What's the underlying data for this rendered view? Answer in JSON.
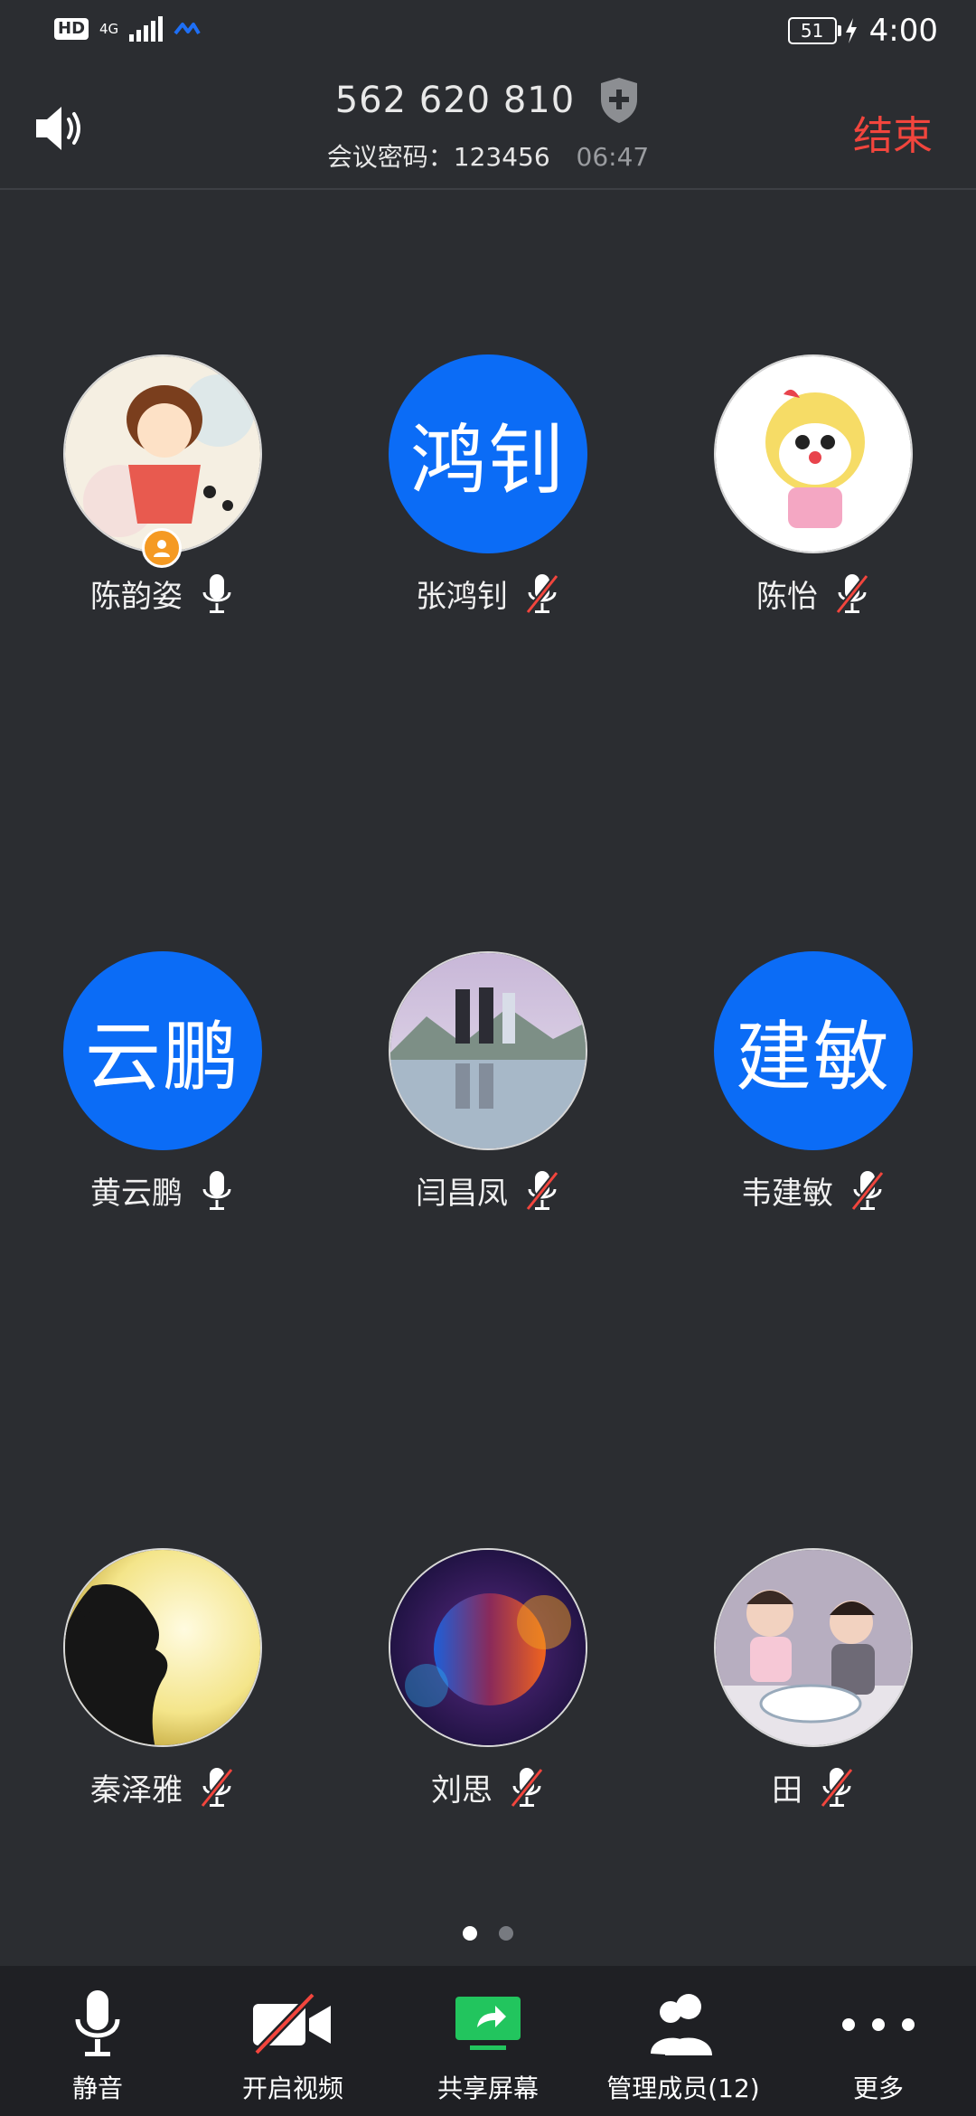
{
  "status_bar": {
    "hd": "HD",
    "network": "4G",
    "battery": "51",
    "time": "4:00"
  },
  "header": {
    "meeting_id": "562 620 810",
    "password_label": "会议密码：123456",
    "duration": "06:47",
    "end_label": "结束"
  },
  "participants": [
    {
      "name": "陈韵姿",
      "avatar_type": "photo",
      "avatar_text": "",
      "mic": "on",
      "host": true
    },
    {
      "name": "张鸿钊",
      "avatar_type": "text",
      "avatar_text": "鸿钊",
      "mic": "muted",
      "host": false
    },
    {
      "name": "陈怡",
      "avatar_type": "photo",
      "avatar_text": "",
      "mic": "muted",
      "host": false
    },
    {
      "name": "黄云鹏",
      "avatar_type": "text",
      "avatar_text": "云鹏",
      "mic": "on",
      "host": false
    },
    {
      "name": "闫昌凤",
      "avatar_type": "photo",
      "avatar_text": "",
      "mic": "muted",
      "host": false
    },
    {
      "name": "韦建敏",
      "avatar_type": "text",
      "avatar_text": "建敏",
      "mic": "muted",
      "host": false
    },
    {
      "name": "秦泽雅",
      "avatar_type": "photo",
      "avatar_text": "",
      "mic": "muted",
      "host": false
    },
    {
      "name": "刘思",
      "avatar_type": "photo",
      "avatar_text": "",
      "mic": "muted",
      "host": false
    },
    {
      "name": "田",
      "avatar_type": "photo",
      "avatar_text": "",
      "mic": "muted",
      "host": false
    }
  ],
  "pager": {
    "pages": 2,
    "current": 1
  },
  "toolbar": {
    "mute": "静音",
    "video": "开启视频",
    "share": "共享屏幕",
    "members": "管理成员(12)",
    "more": "更多"
  },
  "colors": {
    "background": "#2b2d31",
    "toolbar": "#1f2024",
    "accent_blue": "#0b6cf6",
    "end_red": "#f2453d",
    "share_green": "#22c55e",
    "host_badge": "#f59a23"
  }
}
